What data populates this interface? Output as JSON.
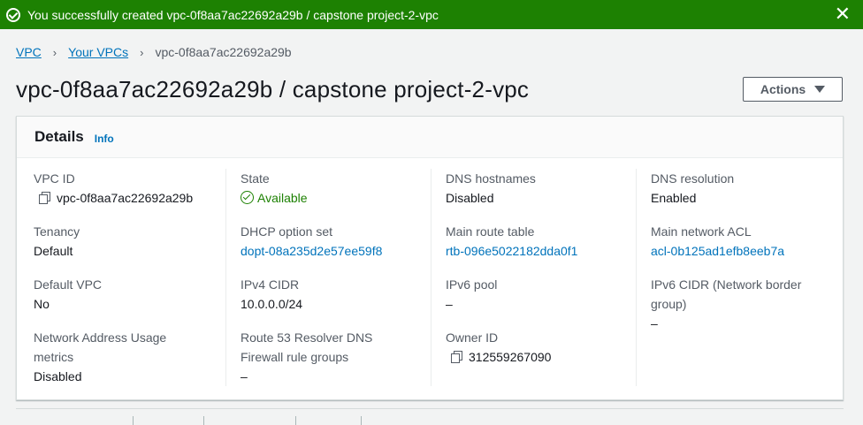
{
  "flash": {
    "message": "You successfully created vpc-0f8aa7ac22692a29b / capstone project-2-vpc",
    "close": "✕"
  },
  "breadcrumb": {
    "root": "VPC",
    "parent": "Your VPCs",
    "current": "vpc-0f8aa7ac22692a29b",
    "separator": "›"
  },
  "page": {
    "title": "vpc-0f8aa7ac22692a29b / capstone project-2-vpc",
    "actions_label": "Actions"
  },
  "details": {
    "heading": "Details",
    "info": "Info",
    "vpc_id": {
      "label": "VPC ID",
      "value": "vpc-0f8aa7ac22692a29b"
    },
    "state": {
      "label": "State",
      "value": "Available"
    },
    "dns_hostnames": {
      "label": "DNS hostnames",
      "value": "Disabled"
    },
    "dns_resolution": {
      "label": "DNS resolution",
      "value": "Enabled"
    },
    "tenancy": {
      "label": "Tenancy",
      "value": "Default"
    },
    "dhcp": {
      "label": "DHCP option set",
      "value": "dopt-08a235d2e57ee59f8"
    },
    "main_route_table": {
      "label": "Main route table",
      "value": "rtb-096e5022182dda0f1"
    },
    "main_acl": {
      "label": "Main network ACL",
      "value": "acl-0b125ad1efb8eeb7a"
    },
    "default_vpc": {
      "label": "Default VPC",
      "value": "No"
    },
    "ipv4_cidr": {
      "label": "IPv4 CIDR",
      "value": "10.0.0.0/24"
    },
    "ipv6_pool": {
      "label": "IPv6 pool",
      "value": "–"
    },
    "ipv6_cidr": {
      "label_line1": "IPv6 CIDR (Network border",
      "label_line2": "group)",
      "value": "–"
    },
    "nau_metrics": {
      "label_line1": "Network Address Usage",
      "label_line2": "metrics",
      "value": "Disabled"
    },
    "r53_dns": {
      "label_line1": "Route 53 Resolver DNS",
      "label_line2": "Firewall rule groups",
      "value": "–"
    },
    "owner_id": {
      "label": "Owner ID",
      "value": "312559267090"
    }
  }
}
